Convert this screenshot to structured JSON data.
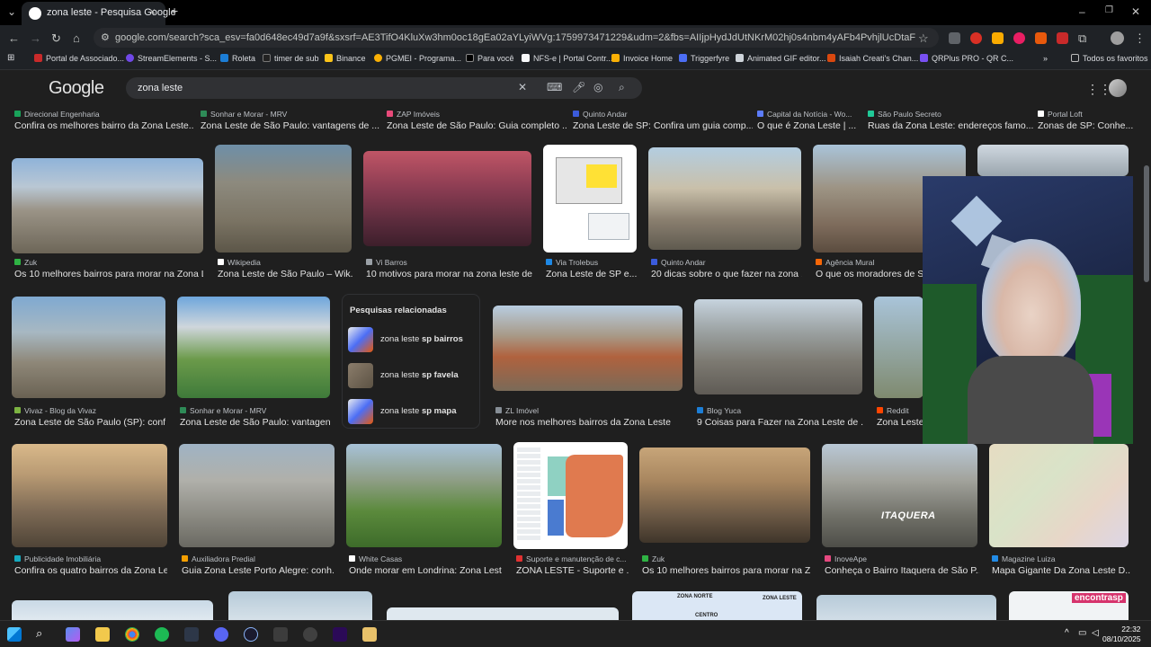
{
  "browser": {
    "tab_title": "zona leste - Pesquisa Google",
    "new_tab": "+",
    "close_tab": "×",
    "url": "google.com/search?sca_esv=fa0d648ec49d7a9f&sxsrf=AE3TifO4KluXw3hm0oc18gEa02aYLyiWVg:1759973471229&udm=2&fbs=AIIjpHydJdUtNKrM02hj0s4nbm4yAFb4PvhjlUcDtaFHkK_tygQfFsXGwfBx7PQbPK0K5a...",
    "bookmarks": [
      "Portal de Associado...",
      "StreamElements - S...",
      "Roleta",
      "timer de sub",
      "Binance",
      "PGMEI - Programa...",
      "Para você",
      "NFS-e | Portal Contr...",
      "Invoice Home",
      "Triggerfyre",
      "Animated GIF editor...",
      "Isaiah Creati's Chan...",
      "QRPlus PRO - QR C..."
    ],
    "bookmarks_overflow": "»",
    "all_bookmarks": "Todos os favoritos"
  },
  "google": {
    "logo": "Google",
    "query": "zona leste"
  },
  "results": {
    "row0": [
      {
        "source": "Direcional Engenharia",
        "caption": "Confira os melhores bairro da Zona Leste...",
        "color": "#19a35a"
      },
      {
        "source": "Sonhar e Morar - MRV",
        "caption": "Zona Leste de São Paulo: vantagens de ...",
        "color": "#2e8b57"
      },
      {
        "source": "ZAP Imóveis",
        "caption": "Zona Leste de São Paulo: Guia completo ...",
        "color": "#e84a7a"
      },
      {
        "source": "Quinto Andar",
        "caption": "Zona Leste de SP: Confira um guia comp...",
        "color": "#3b5bdb"
      },
      {
        "source": "Capital da Notícia - Wo...",
        "caption": "O que é Zona Leste | ...",
        "color": "#5c7cfa"
      },
      {
        "source": "São Paulo Secreto",
        "caption": "Ruas da Zona Leste: endereços famo...",
        "color": "#20c997"
      },
      {
        "source": "Portal Loft",
        "caption": "Zonas de SP: Conhe...",
        "color": "#ffffff"
      }
    ],
    "row1": [
      {
        "source": "Zuk",
        "caption": "Os 10 melhores bairros para morar na Zona L...",
        "color": "#2fb344"
      },
      {
        "source": "Wikipedia",
        "caption": "Zona Leste de São Paulo – Wik...",
        "color": "#ffffff"
      },
      {
        "source": "Vi Barros",
        "caption": "10 motivos para morar na zona leste de ...",
        "color": "#9aa0a6"
      },
      {
        "source": "Via Trolebus",
        "caption": "Zona Leste de SP e...",
        "color": "#1e88e5"
      },
      {
        "source": "Quinto Andar",
        "caption": "20 dicas sobre o que fazer na zona ...",
        "color": "#3b5bdb"
      },
      {
        "source": "Agência Mural",
        "caption": "O que os moradores de São",
        "color": "#f76707"
      }
    ],
    "row2": [
      {
        "source": "Vivaz - Blog da Vivaz",
        "caption": "Zona Leste de São Paulo (SP): conf...",
        "color": "#7cb342"
      },
      {
        "source": "Sonhar e Morar - MRV",
        "caption": "Zona Leste de São Paulo: vantagen...",
        "color": "#2e8b57"
      },
      {
        "source": "ZL Imóvel",
        "caption": "More nos melhores bairros da Zona Leste",
        "color": "#868e96"
      },
      {
        "source": "Blog Yuca",
        "caption": "9 Coisas para Fazer na Zona Leste de ...",
        "color": "#1c7ed6"
      },
      {
        "source": "Reddit",
        "caption": "Zona Leste",
        "color": "#ff4500"
      }
    ],
    "row3": [
      {
        "source": "Publicidade Imobiliária",
        "caption": "Confira os quatro bairros da Zona Le...",
        "color": "#15aabf"
      },
      {
        "source": "Auxiliadora Predial",
        "caption": "Guia Zona Leste Porto Alegre: conh...",
        "color": "#f59f00"
      },
      {
        "source": "White Casas",
        "caption": "Onde morar em Londrina: Zona Lest...",
        "color": "#ffffff"
      },
      {
        "source": "Suporte e manutenção de c...",
        "caption": "ZONA LESTE - Suporte e ...",
        "color": "#e03131"
      },
      {
        "source": "Zuk",
        "caption": "Os 10 melhores bairros para morar na Z...",
        "color": "#2fb344"
      },
      {
        "source": "InoveApe",
        "caption": "Conheça o Bairro Itaquera de São P...",
        "color": "#e64980"
      },
      {
        "source": "Magazine Luiza",
        "caption": "Mapa Gigante Da Zona Leste D...",
        "color": "#228be6"
      }
    ],
    "itaquera_label": "ITAQUERA",
    "map_zona_norte": "ZONA NORTE",
    "map_zona_leste": "ZONA LESTE",
    "map_centro": "CENTRO",
    "encontrasp": "encontrasp"
  },
  "related": {
    "title": "Pesquisas relacionadas",
    "items": [
      {
        "prefix": "zona leste ",
        "bold": "sp bairros"
      },
      {
        "prefix": "zona leste ",
        "bold": "sp favela"
      },
      {
        "prefix": "zona leste ",
        "bold": "sp mapa"
      }
    ]
  },
  "taskbar": {
    "time": "22:32",
    "date": "08/10/2025"
  }
}
